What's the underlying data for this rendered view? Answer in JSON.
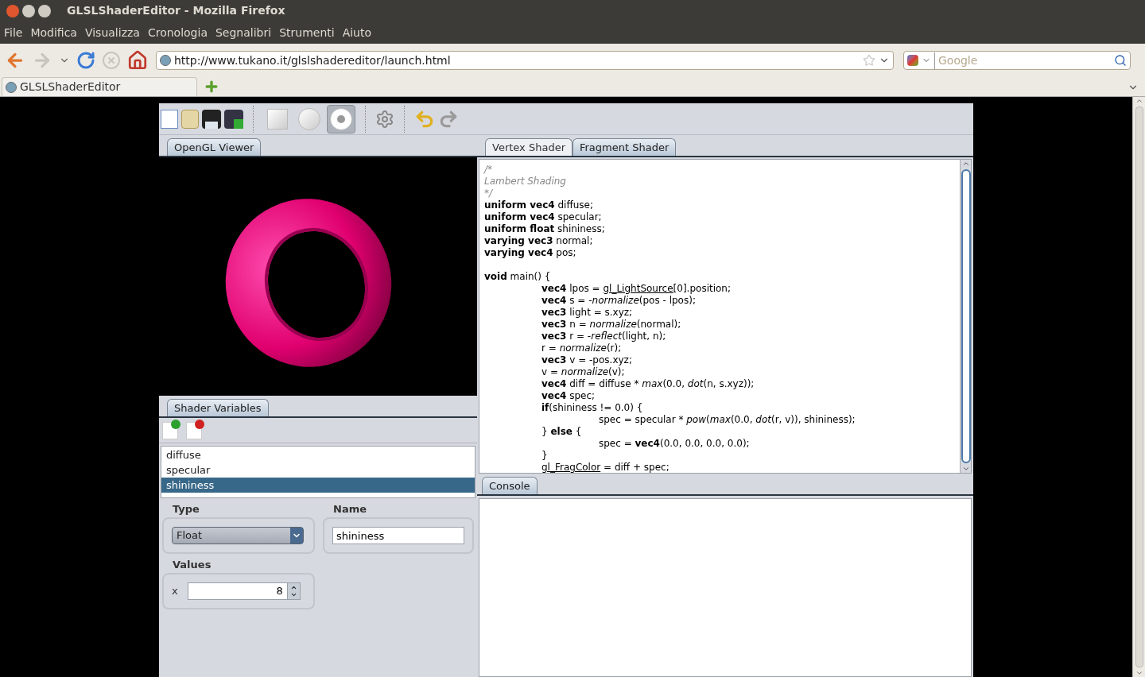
{
  "window": {
    "title": "GLSLShaderEditor - Mozilla Firefox"
  },
  "menu": [
    "File",
    "Modifica",
    "Visualizza",
    "Cronologia",
    "Segnalibri",
    "Strumenti",
    "Aiuto"
  ],
  "address_bar": {
    "value": "http://www.tukano.it/glslshadereditor/launch.html"
  },
  "search": {
    "placeholder": "Google"
  },
  "browser_tabs": [
    {
      "label": "GLSLShaderEditor",
      "selected": true
    }
  ],
  "viewer_tabs": [
    {
      "label": "OpenGL Viewer",
      "selected": true
    }
  ],
  "shader_tabs": [
    {
      "label": "Vertex Shader",
      "selected": false
    },
    {
      "label": "Fragment Shader",
      "selected": true
    }
  ],
  "shape_buttons": [
    {
      "kind": "square",
      "selected": false
    },
    {
      "kind": "sphere",
      "selected": false
    },
    {
      "kind": "torus",
      "selected": true
    }
  ],
  "code": [
    {
      "kind": "top",
      "segments": [
        {
          "kind": "comment",
          "text": "/*"
        }
      ]
    },
    {
      "kind": "top",
      "segments": [
        {
          "kind": "comment",
          "text": "Lambert Shading"
        }
      ]
    },
    {
      "kind": "top",
      "segments": [
        {
          "kind": "comment",
          "text": "*/"
        }
      ]
    },
    {
      "kind": "top",
      "segments": [
        {
          "kind": "keyword",
          "text": "uniform vec4"
        },
        {
          "kind": "plain",
          "text": " diffuse;"
        }
      ]
    },
    {
      "kind": "top",
      "segments": [
        {
          "kind": "keyword",
          "text": "uniform vec4"
        },
        {
          "kind": "plain",
          "text": " specular;"
        }
      ]
    },
    {
      "kind": "top",
      "segments": [
        {
          "kind": "keyword",
          "text": "uniform float"
        },
        {
          "kind": "plain",
          "text": " shininess;"
        }
      ]
    },
    {
      "kind": "top",
      "segments": [
        {
          "kind": "keyword",
          "text": "varying vec3"
        },
        {
          "kind": "plain",
          "text": " normal;"
        }
      ]
    },
    {
      "kind": "top",
      "segments": [
        {
          "kind": "keyword",
          "text": "varying vec4"
        },
        {
          "kind": "plain",
          "text": " pos;"
        }
      ]
    },
    {
      "kind": "blank"
    },
    {
      "kind": "top",
      "segments": [
        {
          "kind": "keyword",
          "text": "void"
        },
        {
          "kind": "plain",
          "text": " main() {"
        }
      ]
    },
    {
      "kind": "inner",
      "segments": [
        {
          "kind": "keyword",
          "text": "vec4"
        },
        {
          "kind": "plain",
          "text": " lpos = "
        },
        {
          "kind": "builtin",
          "text": "gl_LightSource"
        },
        {
          "kind": "plain",
          "text": "[0].position;"
        }
      ]
    },
    {
      "kind": "inner",
      "segments": [
        {
          "kind": "keyword",
          "text": "vec4"
        },
        {
          "kind": "plain",
          "text": " s = -"
        },
        {
          "kind": "function",
          "text": "normalize"
        },
        {
          "kind": "plain",
          "text": "(pos - lpos);"
        }
      ]
    },
    {
      "kind": "inner",
      "segments": [
        {
          "kind": "keyword",
          "text": "vec3"
        },
        {
          "kind": "plain",
          "text": " light = s.xyz;"
        }
      ]
    },
    {
      "kind": "inner",
      "segments": [
        {
          "kind": "keyword",
          "text": "vec3"
        },
        {
          "kind": "plain",
          "text": " n = "
        },
        {
          "kind": "function",
          "text": "normalize"
        },
        {
          "kind": "plain",
          "text": "(normal);"
        }
      ]
    },
    {
      "kind": "inner",
      "segments": [
        {
          "kind": "keyword",
          "text": "vec3"
        },
        {
          "kind": "plain",
          "text": " r = -"
        },
        {
          "kind": "function",
          "text": "reflect"
        },
        {
          "kind": "plain",
          "text": "(light, n);"
        }
      ]
    },
    {
      "kind": "inner",
      "segments": [
        {
          "kind": "plain",
          "text": "r = "
        },
        {
          "kind": "function",
          "text": "normalize"
        },
        {
          "kind": "plain",
          "text": "(r);"
        }
      ]
    },
    {
      "kind": "inner",
      "segments": [
        {
          "kind": "keyword",
          "text": "vec3"
        },
        {
          "kind": "plain",
          "text": " v = -pos.xyz;"
        }
      ]
    },
    {
      "kind": "inner",
      "segments": [
        {
          "kind": "plain",
          "text": "v = "
        },
        {
          "kind": "function",
          "text": "normalize"
        },
        {
          "kind": "plain",
          "text": "(v);"
        }
      ]
    },
    {
      "kind": "inner",
      "segments": [
        {
          "kind": "keyword",
          "text": "vec4"
        },
        {
          "kind": "plain",
          "text": " diff = diffuse * "
        },
        {
          "kind": "function",
          "text": "max"
        },
        {
          "kind": "plain",
          "text": "(0.0, "
        },
        {
          "kind": "function",
          "text": "dot"
        },
        {
          "kind": "plain",
          "text": "(n, s.xyz));"
        }
      ]
    },
    {
      "kind": "inner",
      "segments": [
        {
          "kind": "keyword",
          "text": "vec4"
        },
        {
          "kind": "plain",
          "text": " spec;"
        }
      ]
    },
    {
      "kind": "inner",
      "segments": [
        {
          "kind": "keyword",
          "text": "if"
        },
        {
          "kind": "plain",
          "text": "(shininess != 0.0) {"
        }
      ]
    },
    {
      "kind": "deep",
      "segments": [
        {
          "kind": "plain",
          "text": "spec = specular * "
        },
        {
          "kind": "function",
          "text": "pow"
        },
        {
          "kind": "plain",
          "text": "("
        },
        {
          "kind": "function",
          "text": "max"
        },
        {
          "kind": "plain",
          "text": "(0.0, "
        },
        {
          "kind": "function",
          "text": "dot"
        },
        {
          "kind": "plain",
          "text": "(r, v)), shininess);"
        }
      ]
    },
    {
      "kind": "inner",
      "segments": [
        {
          "kind": "plain",
          "text": "} "
        },
        {
          "kind": "keyword",
          "text": "else"
        },
        {
          "kind": "plain",
          "text": " {"
        }
      ]
    },
    {
      "kind": "deep",
      "segments": [
        {
          "kind": "plain",
          "text": "spec = "
        },
        {
          "kind": "keyword",
          "text": "vec4"
        },
        {
          "kind": "plain",
          "text": "(0.0, 0.0, 0.0, 0.0);"
        }
      ]
    },
    {
      "kind": "inner",
      "segments": [
        {
          "kind": "plain",
          "text": "}"
        }
      ]
    },
    {
      "kind": "inner",
      "segments": [
        {
          "kind": "builtin",
          "text": "gl_FragColor"
        },
        {
          "kind": "plain",
          "text": " = diff + spec;"
        }
      ]
    }
  ],
  "variables_tabs": [
    {
      "label": "Shader Variables",
      "selected": true
    }
  ],
  "variables": [
    {
      "name": "diffuse",
      "selected": false
    },
    {
      "name": "specular",
      "selected": false
    },
    {
      "name": "shininess",
      "selected": true
    }
  ],
  "type": {
    "label": "Type",
    "value": "Float"
  },
  "name": {
    "label": "Name",
    "value": "shininess"
  },
  "values": {
    "label": "Values",
    "fields": [
      {
        "axis": "x",
        "value": "8"
      }
    ]
  },
  "console_tabs": [
    {
      "label": "Console",
      "selected": true
    }
  ]
}
